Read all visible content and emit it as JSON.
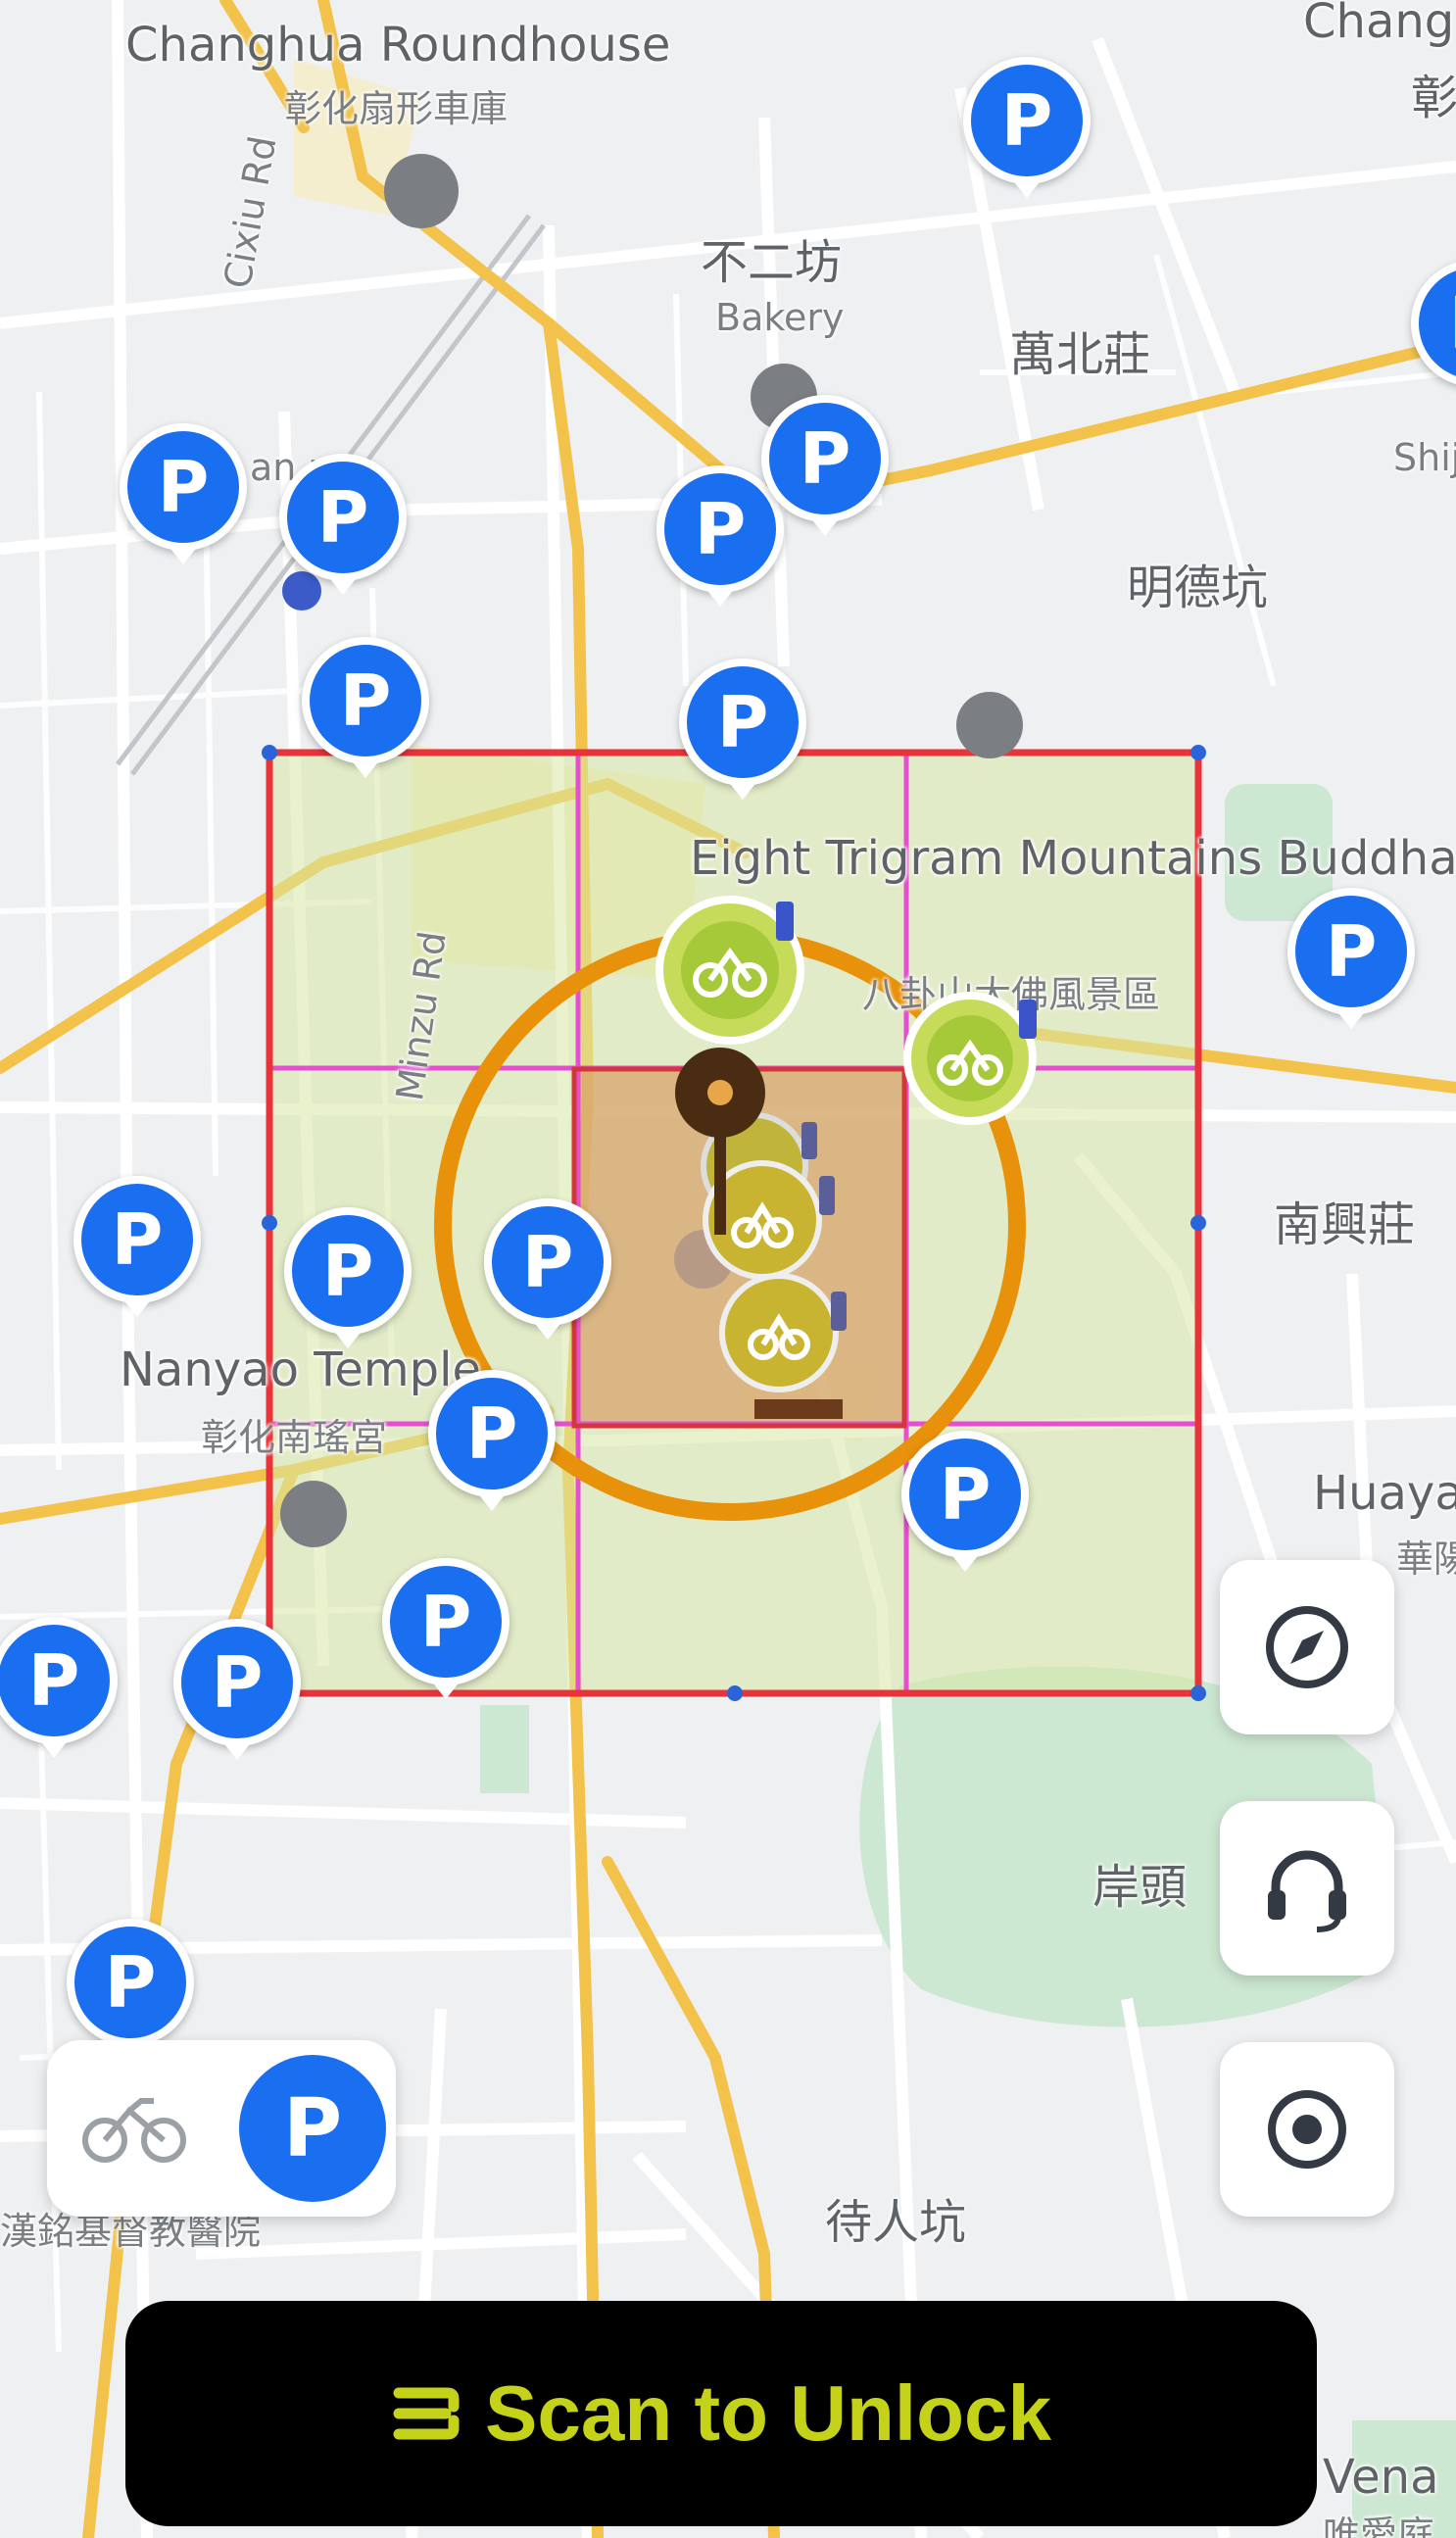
{
  "map": {
    "labels": {
      "roundhouse_en": "Changhua Roundhouse",
      "roundhouse_zh": "彰化扇形車庫",
      "bakery_zh": "不二坊",
      "bakery_en": "Bakery",
      "wanbeizhuang": "萬北莊",
      "mingdekeng": "明德坑",
      "changhua_corner": "Chang",
      "changhua_corner_zh": "彰",
      "shiji": "Shij",
      "cixiu_rd": "Cixiu Rd",
      "minzu_rd": "Minzu Rd",
      "baguashan_en": "Eight Trigram Mountains Buddha Landscape",
      "baguashan_zh": "八卦山大佛風景區",
      "nanxingzhuang": "南興莊",
      "nanyao_en": "Nanyao Temple",
      "nanyao_zh": "彰化南瑤宮",
      "huaya_en": "Huaya",
      "huaya_zh": "華陽",
      "antou": "岸頭",
      "dairenkeng": "待人坑",
      "vena_en": "Vena",
      "vena_zh": "唯愛庭",
      "station_partial": "an  ua",
      "church_partial": "漢銘基督教醫院"
    },
    "parking_pin_glyph": "P",
    "marker_icons": [
      "bike-icon",
      "battery-icon",
      "map-pin-icon",
      "parking-icon"
    ]
  },
  "controls": {
    "compass_icon": "compass-icon",
    "support_icon": "headset-icon",
    "locate_icon": "locate-icon",
    "mode_toggle": {
      "bike_icon": "bike-icon",
      "parking_label": "P"
    }
  },
  "scan_button": {
    "label": "Scan to Unlock",
    "icon": "scan-icon"
  },
  "colors": {
    "parking_blue": "#1a6ff0",
    "bike_green": "#a6c93a",
    "grid_red": "#e8333a",
    "grid_magenta": "#e44fd2",
    "ring_orange": "#e8910a",
    "scan_text": "#c5d21a"
  }
}
